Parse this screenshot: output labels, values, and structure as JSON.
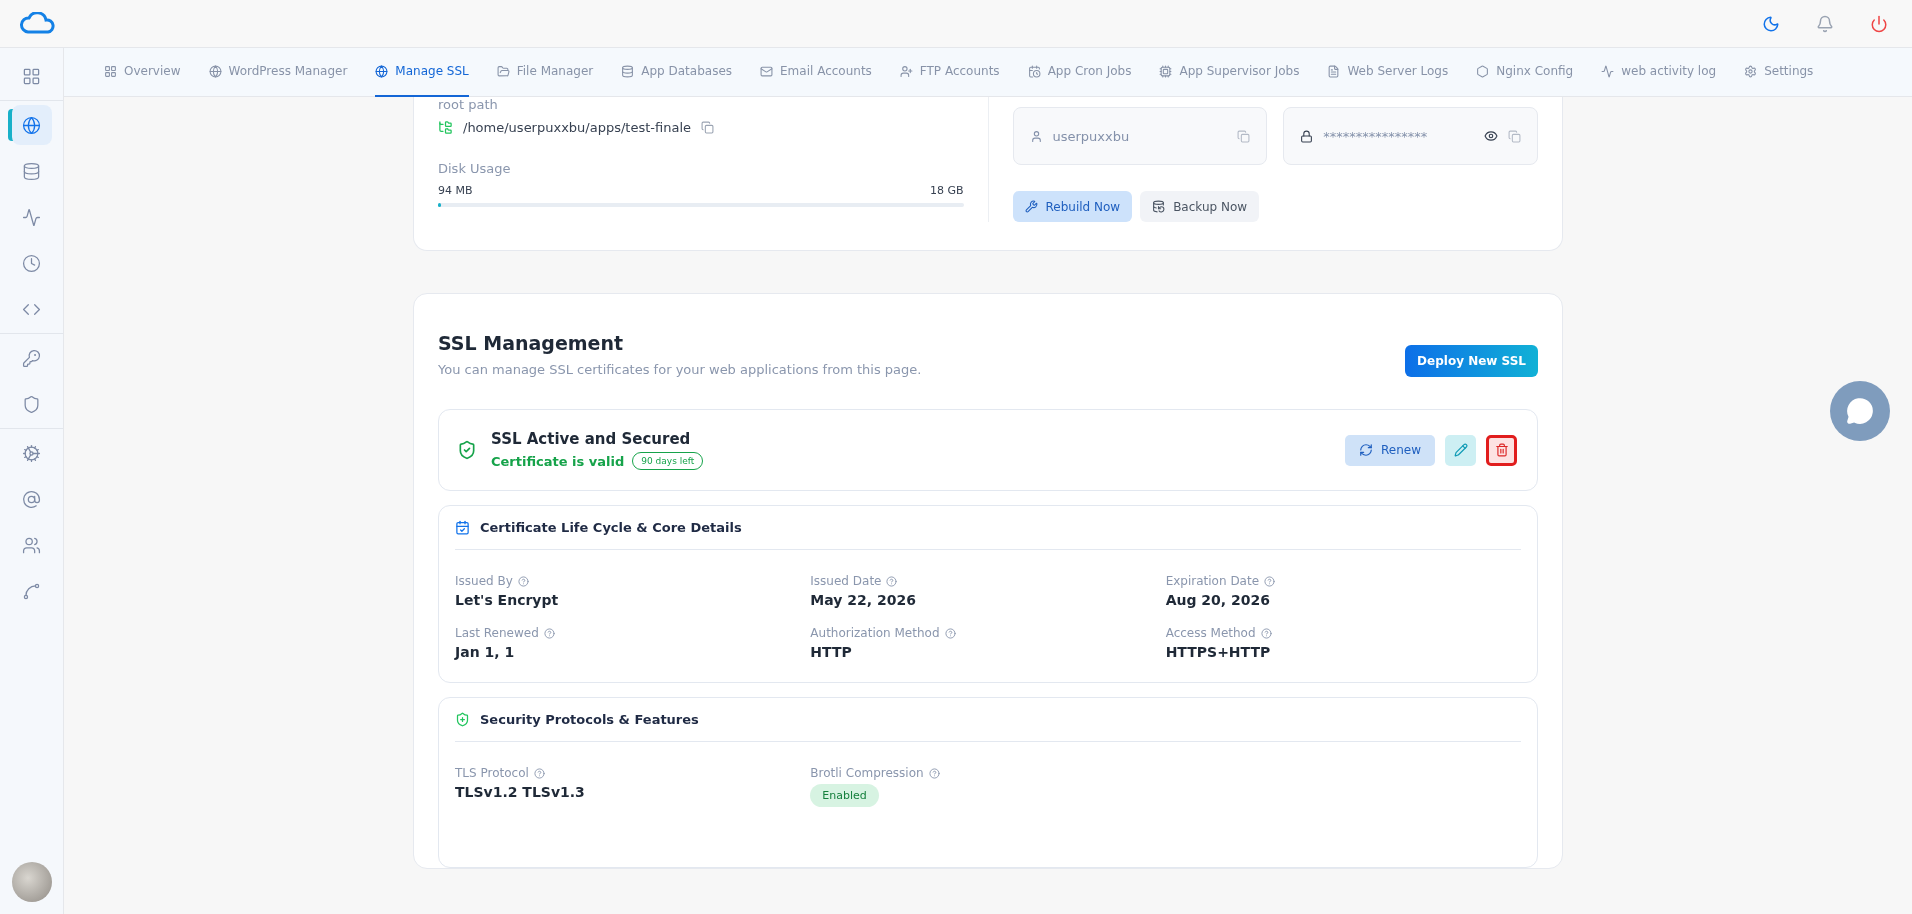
{
  "tabs": [
    {
      "label": "Overview",
      "selected": false
    },
    {
      "label": "WordPress Manager",
      "selected": false
    },
    {
      "label": "Manage SSL",
      "selected": true
    },
    {
      "label": "File Manager",
      "selected": false
    },
    {
      "label": "App Databases",
      "selected": false
    },
    {
      "label": "Email Accounts",
      "selected": false
    },
    {
      "label": "FTP Accounts",
      "selected": false
    },
    {
      "label": "App Cron Jobs",
      "selected": false
    },
    {
      "label": "App Supervisor Jobs",
      "selected": false
    },
    {
      "label": "Web Server Logs",
      "selected": false
    },
    {
      "label": "Nginx Config",
      "selected": false
    },
    {
      "label": "web activity log",
      "selected": false
    },
    {
      "label": "Settings",
      "selected": false
    }
  ],
  "sidebar": {
    "groups": [
      [
        {
          "selected": false
        }
      ],
      [
        {
          "selected": true
        },
        {
          "selected": false
        },
        {
          "selected": false
        },
        {
          "selected": false
        },
        {
          "selected": false
        }
      ],
      [
        {
          "selected": false
        },
        {
          "selected": false
        }
      ],
      [
        {
          "selected": false
        },
        {
          "selected": false
        },
        {
          "selected": false
        },
        {
          "selected": false
        }
      ]
    ]
  },
  "app_card": {
    "root_path_label": "root path",
    "root_path": "/home/userpuxxbu/apps/test-finale",
    "disk_usage": {
      "label": "Disk Usage",
      "used": "94 MB",
      "total": "18 GB",
      "level": 0.005
    },
    "username": "userpuxxbu",
    "password": "****************",
    "buttons": [
      {
        "label": "Rebuild Now",
        "kind": "rebuild"
      },
      {
        "label": "Backup Now",
        "kind": "backup"
      }
    ]
  },
  "ssl": {
    "title": "SSL Management",
    "subtitle": "You can manage SSL certificates for your web applications from this page.",
    "deploy_button": "Deploy New SSL",
    "status": {
      "title": "SSL Active and Secured",
      "validity": "Certificate is valid",
      "days_left": "90 days left",
      "actions": [
        {
          "kind": "renew",
          "label": "Renew",
          "highlighted": false
        },
        {
          "kind": "edit",
          "highlighted": false
        },
        {
          "kind": "delete",
          "highlighted": true
        }
      ]
    },
    "details": {
      "title": "Certificate Life Cycle & Core Details",
      "fields": [
        {
          "label": "Issued By",
          "value": "Let's Encrypt"
        },
        {
          "label": "Issued Date",
          "value": "May 22, 2026"
        },
        {
          "label": "Expiration Date",
          "value": "Aug 20, 2026"
        },
        {
          "label": "Last Renewed",
          "value": "Jan 1, 1"
        },
        {
          "label": "Authorization Method",
          "value": "HTTP"
        },
        {
          "label": "Access Method",
          "value": "HTTPS+HTTP"
        }
      ]
    },
    "security": {
      "title": "Security Protocols & Features",
      "fields": [
        {
          "label": "TLS Protocol",
          "value": "TLSv1.2 TLSv1.3",
          "kind": "text"
        },
        {
          "label": "Brotli Compression",
          "value": "Enabled",
          "kind": "badge"
        }
      ]
    }
  }
}
